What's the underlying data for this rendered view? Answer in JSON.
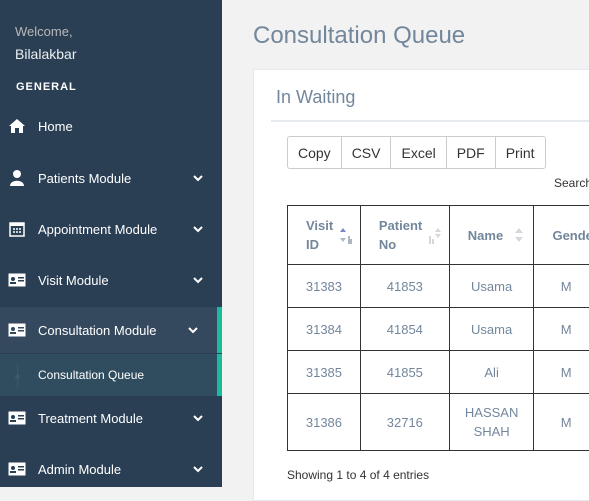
{
  "sidebar": {
    "welcome": "Welcome,",
    "username": "Bilalakbar",
    "section_title": "GENERAL",
    "items": [
      {
        "label": "Home",
        "icon": "home-icon"
      },
      {
        "label": "Patients Module",
        "icon": "user-icon"
      },
      {
        "label": "Appointment Module",
        "icon": "calendar-icon"
      },
      {
        "label": "Visit Module",
        "icon": "id-card-icon"
      },
      {
        "label": "Consultation Module",
        "icon": "id-card-icon"
      },
      {
        "label": "Treatment Module",
        "icon": "id-card-icon"
      },
      {
        "label": "Admin Module",
        "icon": "id-card-icon"
      }
    ],
    "submenu": {
      "label": "Consultation Queue"
    }
  },
  "main": {
    "page_title": "Consultation Queue",
    "panel_title": "In Waiting",
    "buttons": [
      "Copy",
      "CSV",
      "Excel",
      "PDF",
      "Print"
    ],
    "search_label": "Search",
    "table": {
      "headers": [
        {
          "line1": "Visit",
          "line2": "ID"
        },
        {
          "line1": "Patient",
          "line2": "No"
        },
        {
          "line1": "Name",
          "line2": ""
        },
        {
          "line1": "Gender",
          "line2": ""
        }
      ],
      "rows": [
        {
          "visit_id": "31383",
          "patient_no": "41853",
          "name": "Usama",
          "gender": "M"
        },
        {
          "visit_id": "31384",
          "patient_no": "41854",
          "name": "Usama",
          "gender": "M"
        },
        {
          "visit_id": "31385",
          "patient_no": "41855",
          "name": "Ali",
          "gender": "M"
        },
        {
          "visit_id": "31386",
          "patient_no": "32716",
          "name": "HASSAN SHAH",
          "gender": "M"
        }
      ]
    },
    "info": "Showing 1 to 4 of 4 entries"
  },
  "colors": {
    "sidebar_bg": "#2a3f54",
    "accent": "#1abb9c",
    "text_muted": "#73879c"
  }
}
